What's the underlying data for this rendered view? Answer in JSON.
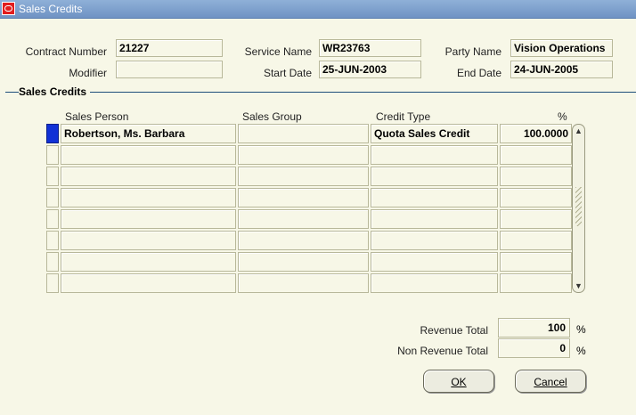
{
  "window": {
    "title": "Sales Credits"
  },
  "header": {
    "contract_number_label": "Contract Number",
    "contract_number": "21227",
    "modifier_label": "Modifier",
    "modifier": "",
    "service_name_label": "Service Name",
    "service_name": "WR23763",
    "start_date_label": "Start Date",
    "start_date": "25-JUN-2003",
    "party_name_label": "Party Name",
    "party_name": "Vision Operations",
    "end_date_label": "End Date",
    "end_date": "24-JUN-2005"
  },
  "section": {
    "title": "Sales Credits"
  },
  "table": {
    "columns": [
      "Sales Person",
      "Sales Group",
      "Credit Type",
      "%"
    ],
    "rows": [
      {
        "sales_person": "Robertson, Ms. Barbara",
        "sales_group": "",
        "credit_type": "Quota Sales Credit",
        "percent": "100.0000"
      },
      {
        "sales_person": "",
        "sales_group": "",
        "credit_type": "",
        "percent": ""
      },
      {
        "sales_person": "",
        "sales_group": "",
        "credit_type": "",
        "percent": ""
      },
      {
        "sales_person": "",
        "sales_group": "",
        "credit_type": "",
        "percent": ""
      },
      {
        "sales_person": "",
        "sales_group": "",
        "credit_type": "",
        "percent": ""
      },
      {
        "sales_person": "",
        "sales_group": "",
        "credit_type": "",
        "percent": ""
      },
      {
        "sales_person": "",
        "sales_group": "",
        "credit_type": "",
        "percent": ""
      },
      {
        "sales_person": "",
        "sales_group": "",
        "credit_type": "",
        "percent": ""
      }
    ]
  },
  "totals": {
    "revenue_label": "Revenue Total",
    "revenue_value": "100",
    "non_revenue_label": "Non Revenue Total",
    "non_revenue_value": "0",
    "percent_sign": "%"
  },
  "buttons": {
    "ok_label": "OK",
    "cancel_label": "Cancel"
  },
  "colors": {
    "titlebar": "#6f93c4",
    "background": "#f7f7e7",
    "selected_row_indicator": "#1131d6"
  }
}
